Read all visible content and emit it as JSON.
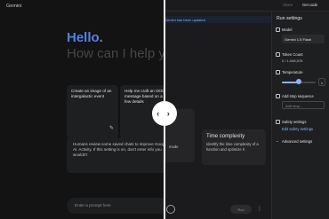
{
  "left": {
    "app_title": "Gemini",
    "hello": "Hello.",
    "help": "How can I help you",
    "card_1": "Create an image of an intergalactic event",
    "card_2": "Help me craft an OOO message based on a few details",
    "disclaimer": "Humans review some saved chats to improve Google AI. Activity. If this setting is on, don't enter info you wouldn't",
    "input_placeholder": "Enter a prompt here"
  },
  "right": {
    "share": "Share",
    "get_code": "Get code",
    "banner": "Gemini has been updated",
    "card_3_text": "mode",
    "card_4_title": "Time complexity",
    "card_4_text": "Identify the time complexity of a function and optimize it",
    "run": "Run",
    "panel": {
      "title": "Run settings",
      "model_label": "Model",
      "model_value": "Gemini 1.5 Flash",
      "token_label": "Token Count",
      "token_value": "0 / 1,048,576",
      "temperature_label": "Temperature",
      "temperature_value": "1",
      "temperature_fraction": 0.5,
      "stop_label": "Add stop sequence",
      "stop_placeholder": "Add stop...",
      "safety_label": "Safety settings",
      "safety_link": "Edit safety settings",
      "advanced_label": "Advanced settings"
    }
  },
  "toggle_glyph": "‹ ›"
}
